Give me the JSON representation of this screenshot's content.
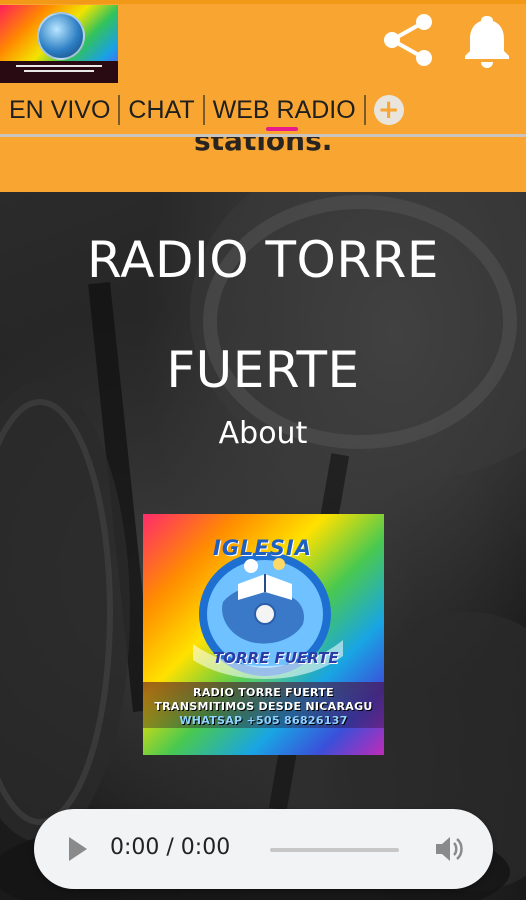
{
  "header": {
    "logo_name": "iglesia-torre-fuerte-logo",
    "icons": [
      "share-icon",
      "bell-icon"
    ],
    "tabs": [
      {
        "label": "EN VIVO",
        "active": false
      },
      {
        "label": "CHAT",
        "active": false
      },
      {
        "label": "WEB RADIO",
        "active": true
      }
    ],
    "add_tab_icon": "plus-circle-icon"
  },
  "strip": {
    "partial_text": "stations."
  },
  "hero": {
    "title_line1": "RADIO TORRE",
    "title_line2": "FUERTE",
    "about": "About"
  },
  "station_logo": {
    "arc_top": "IGLESIA",
    "arc_bottom": "TORRE FUERTE",
    "line1": "RADIO TORRE FUERTE",
    "line2": "TRANSMITIMOS DESDE NICARAGU",
    "line3": "WHATSAP +505 86826137"
  },
  "player": {
    "time": "0:00 / 0:00",
    "progress": 0,
    "icons": [
      "play-icon",
      "volume-icon"
    ]
  },
  "colors": {
    "header_bg": "#f8a532",
    "active_tab_underline": "#e8198a",
    "player_bg": "#f1f3f4",
    "hero_text": "#ffffff"
  }
}
